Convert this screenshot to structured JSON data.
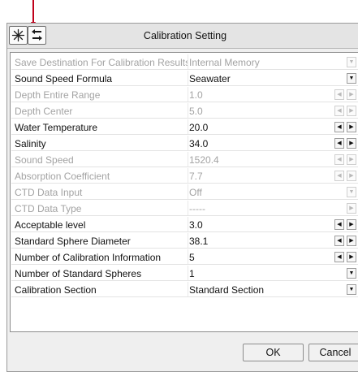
{
  "window": {
    "title": "Calibration Setting"
  },
  "icons": {
    "toolbar_left": "snowflake-icon",
    "toolbar_right": "swap-arrows-icon"
  },
  "rows": [
    {
      "label": "Save Destination For Calibration Results",
      "value": "Internal Memory",
      "enabled": false,
      "control": "dropdown"
    },
    {
      "label": "Sound Speed Formula",
      "value": "Seawater",
      "enabled": true,
      "control": "dropdown"
    },
    {
      "label": "Depth Entire Range",
      "value": "1.0",
      "enabled": false,
      "control": "stepper"
    },
    {
      "label": "Depth Center",
      "value": "5.0",
      "enabled": false,
      "control": "stepper"
    },
    {
      "label": "Water Temperature",
      "value": "20.0",
      "enabled": true,
      "control": "stepper"
    },
    {
      "label": "Salinity",
      "value": "34.0",
      "enabled": true,
      "control": "stepper"
    },
    {
      "label": "Sound Speed",
      "value": "1520.4",
      "enabled": false,
      "control": "stepper"
    },
    {
      "label": "Absorption Coefficient",
      "value": "7.7",
      "enabled": false,
      "control": "stepper"
    },
    {
      "label": "CTD Data Input",
      "value": "Off",
      "enabled": false,
      "control": "dropdown"
    },
    {
      "label": "CTD Data Type",
      "value": "-----",
      "enabled": false,
      "control": "dropdown-right"
    },
    {
      "label": "Acceptable level",
      "value": "3.0",
      "enabled": true,
      "control": "stepper"
    },
    {
      "label": "Standard Sphere Diameter",
      "value": "38.1",
      "enabled": true,
      "control": "stepper"
    },
    {
      "label": "Number of Calibration Information",
      "value": "5",
      "enabled": true,
      "control": "stepper"
    },
    {
      "label": "Number of Standard Spheres",
      "value": "1",
      "enabled": true,
      "control": "dropdown"
    },
    {
      "label": "Calibration Section",
      "value": "Standard Section",
      "enabled": true,
      "control": "dropdown"
    }
  ],
  "buttons": {
    "ok": "OK",
    "cancel": "Cancel"
  },
  "colors": {
    "annotation": "#c0001a",
    "disabled_text": "#a3a3a3"
  }
}
